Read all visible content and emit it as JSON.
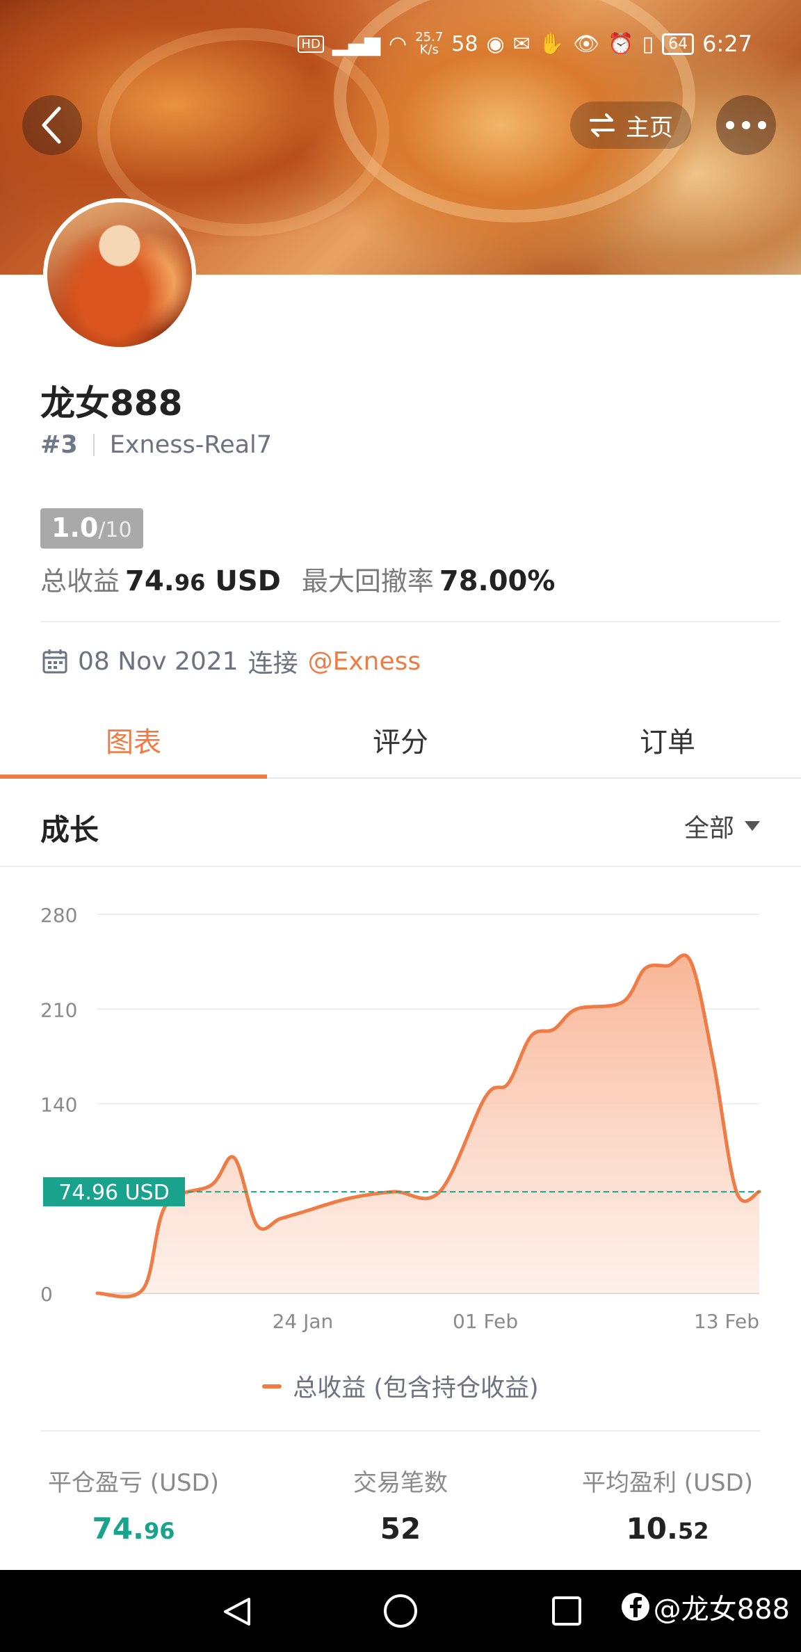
{
  "status_bar": {
    "speed_value": "25.7",
    "speed_unit": "K/s",
    "notify_count": "58",
    "battery": "64",
    "time": "6:27"
  },
  "header": {
    "home_label": "主页"
  },
  "profile": {
    "name": "龙女888",
    "rank": "#3",
    "account": "Exness-Real7",
    "score": "1.0",
    "score_max": "/10",
    "total_profit_label": "总收益",
    "total_profit_int": "74.",
    "total_profit_dec": "96",
    "total_profit_unit": "USD",
    "max_drawdown_label": "最大回撤率",
    "max_drawdown": "78.00%",
    "connect_date": "08 Nov 2021",
    "connect_label": "连接",
    "broker": "@Exness"
  },
  "tabs": [
    {
      "label": "图表",
      "active": true
    },
    {
      "label": "评分",
      "active": false
    },
    {
      "label": "订单",
      "active": false
    }
  ],
  "section": {
    "title": "成长",
    "range": "全部"
  },
  "chart_data": {
    "type": "area",
    "x": [
      "15 Jan",
      "17 Jan",
      "18 Jan",
      "20 Jan",
      "21 Jan",
      "22 Jan",
      "23 Jan",
      "24 Jan",
      "26 Jan",
      "28 Jan",
      "30 Jan",
      "01 Feb",
      "02 Feb",
      "03 Feb",
      "04 Feb",
      "05 Feb",
      "07 Feb",
      "08 Feb",
      "09 Feb",
      "10 Feb",
      "11 Feb",
      "12 Feb",
      "13 Feb"
    ],
    "y": [
      0,
      3,
      65,
      80,
      100,
      50,
      55,
      60,
      70,
      75,
      75,
      145,
      155,
      190,
      195,
      210,
      215,
      240,
      242,
      245,
      170,
      75,
      75
    ],
    "x_ticks": [
      "24 Jan",
      "01 Feb",
      "13 Feb"
    ],
    "y_ticks": [
      0,
      140,
      210,
      280
    ],
    "ylim": [
      0,
      280
    ],
    "reference_line": {
      "value": 74.96,
      "label": "74.96 USD"
    },
    "series_name": "总收益 (包含持仓收益)",
    "line_color": "#ef7b45",
    "reference_color": "#1aa38c"
  },
  "stats": [
    {
      "label": "平仓盈亏 (USD)",
      "int": "74.",
      "dec": "96",
      "color": "green"
    },
    {
      "label": "交易笔数",
      "int": "52",
      "dec": "",
      "color": "default"
    },
    {
      "label": "平均盈利 (USD)",
      "int": "10.",
      "dec": "52",
      "color": "default"
    }
  ],
  "watermark": "@龙女888",
  "colors": {
    "accent": "#ef7b45",
    "positive": "#1aa38c",
    "badge_grey": "#a9a9a9"
  }
}
